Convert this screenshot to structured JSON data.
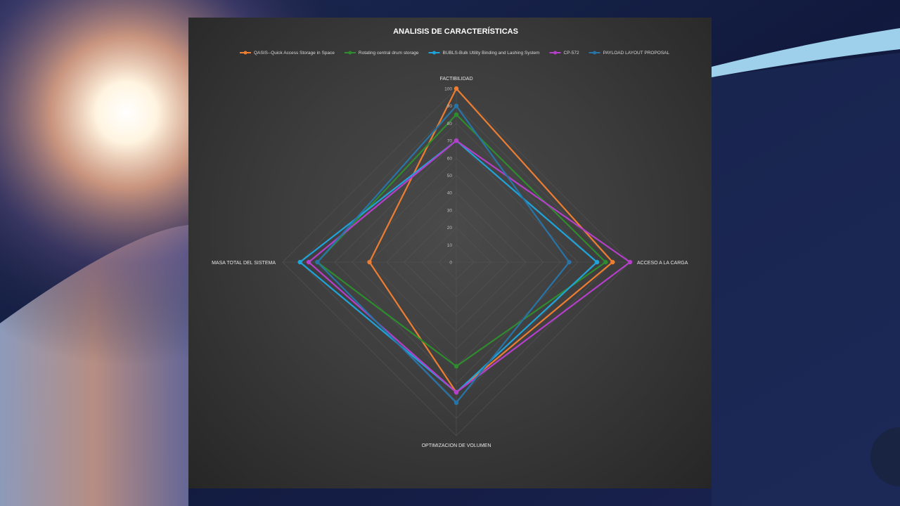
{
  "colors": {
    "chart_background": "#3a3a3a",
    "grid": "#555555"
  },
  "chart_data": {
    "type": "radar",
    "title": "ANALISIS DE CARACTERÍSTICAS",
    "axes": [
      "FACTIBILIDAD",
      "ACCESO A LA CARGA",
      "OPTIMIZACION DE VOLUMEN",
      "MASA TOTAL DEL SISTEMA"
    ],
    "rlim": [
      0,
      100
    ],
    "ticks": [
      0,
      10,
      20,
      30,
      40,
      50,
      60,
      70,
      80,
      90,
      100
    ],
    "grid": true,
    "legend_position": "top",
    "series": [
      {
        "name": "QASIS--Quick Access Storage in Space",
        "color": "#ed7d31",
        "values": [
          100,
          90,
          75,
          50
        ]
      },
      {
        "name": "Rotating central drum storage",
        "color": "#2e8b2e",
        "values": [
          85,
          86,
          60,
          80
        ]
      },
      {
        "name": "BUBLS-Bulk Utility Binding and Lashing System",
        "color": "#1fa3d8",
        "values": [
          70,
          81,
          75,
          90
        ]
      },
      {
        "name": "CP-572",
        "color": "#b43fc9",
        "values": [
          70,
          100,
          75,
          85
        ]
      },
      {
        "name": "PAYLOAD LAYOUT PROPOSAL",
        "color": "#2874a6",
        "values": [
          90,
          65,
          81,
          80
        ]
      }
    ]
  }
}
